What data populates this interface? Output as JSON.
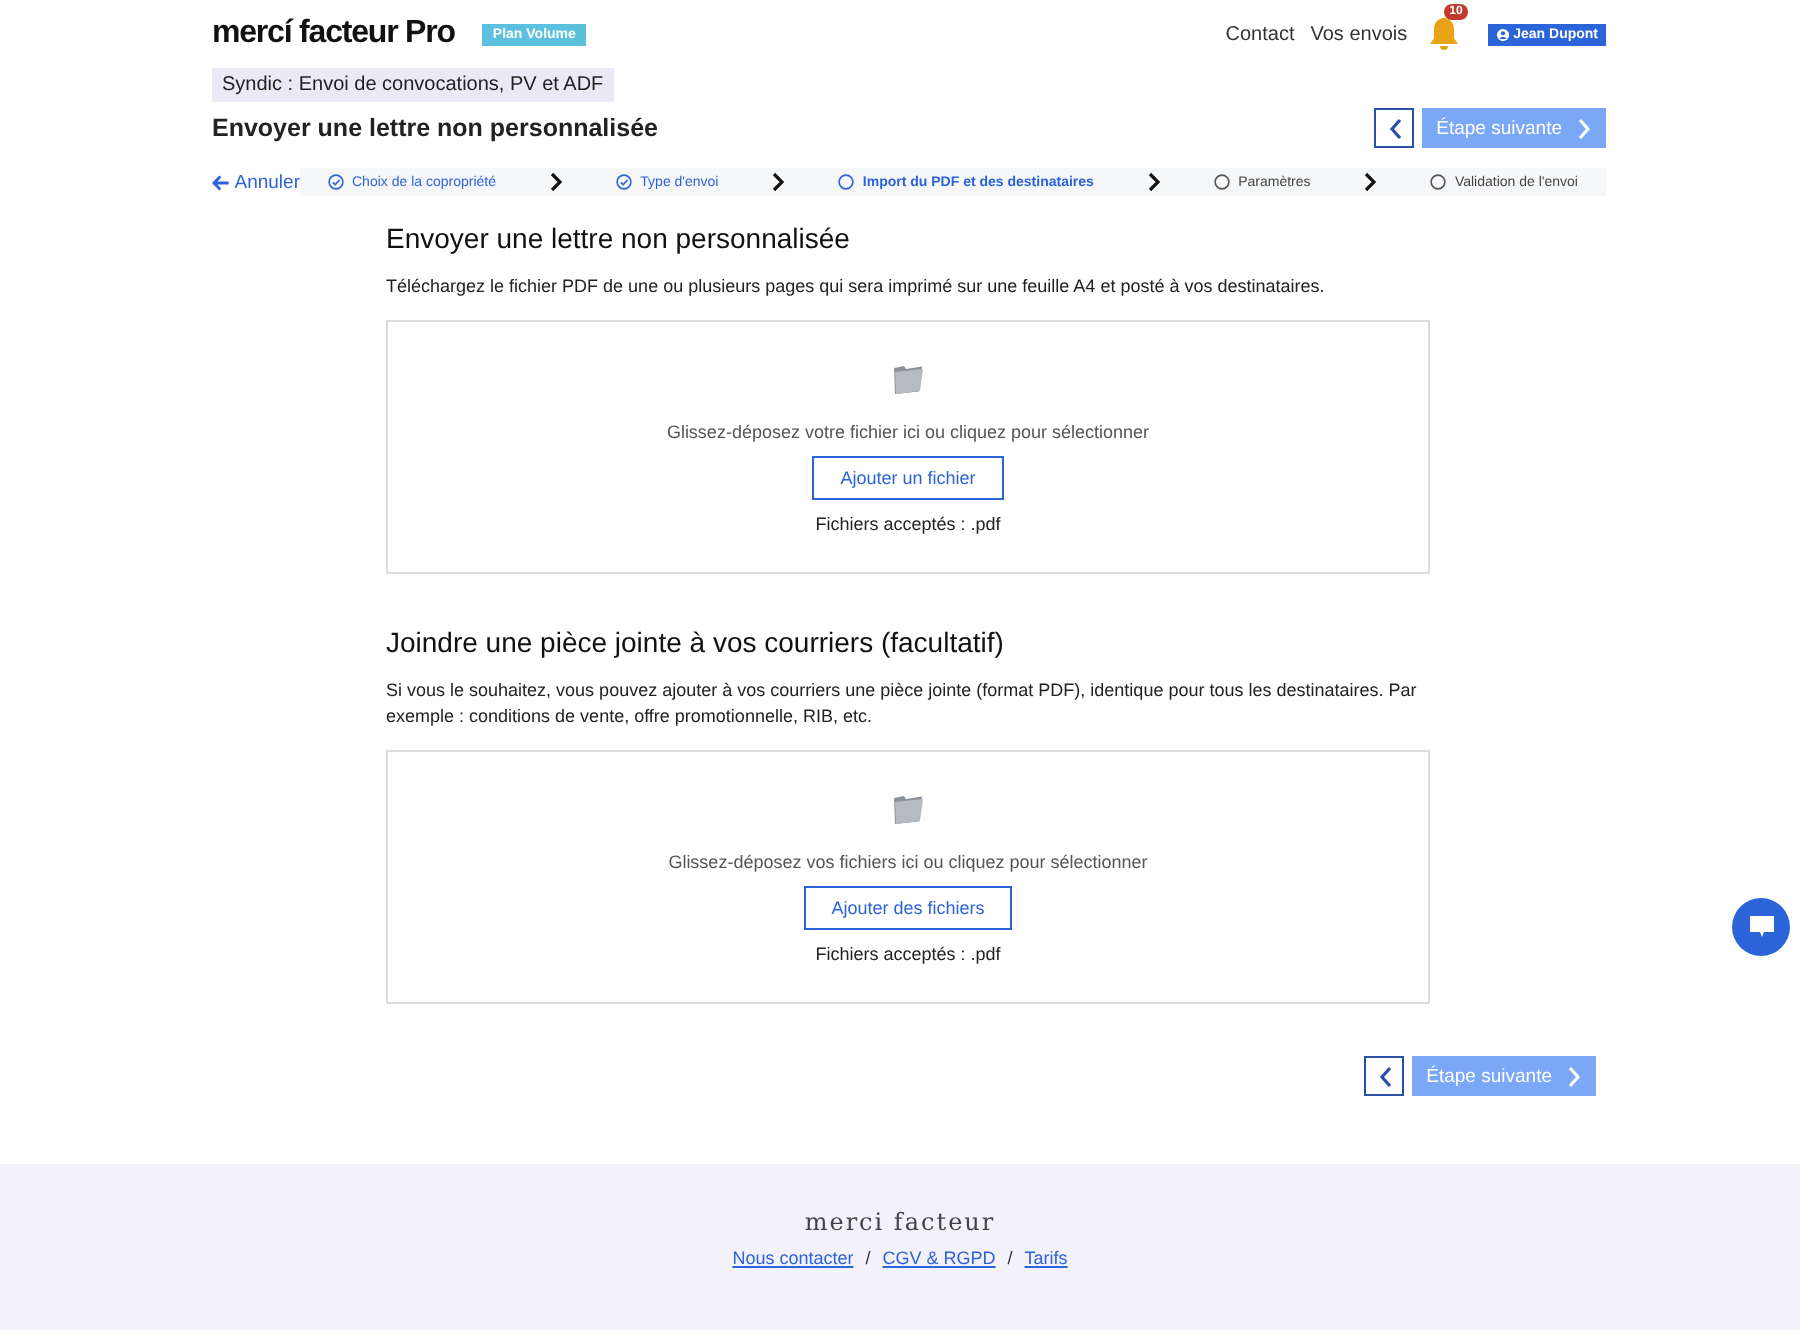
{
  "header": {
    "logo": "mercí facteur Pro",
    "plan_badge": "Plan Volume",
    "nav": [
      "Contact",
      "Vos envois"
    ],
    "notification_count": "10",
    "user": "Jean Dupont"
  },
  "context_tag": "Syndic : Envoi de convocations, PV et ADF",
  "page_title": "Envoyer une lettre non personnalisée",
  "next_button": "Étape suivante",
  "bottom_next_button": "Étape suivante",
  "cancel": "Annuler",
  "steps": [
    {
      "label": "Choix de la copropriété",
      "kind": "done",
      "selected": false
    },
    {
      "label": "Type d'envoi",
      "kind": "done",
      "selected": false
    },
    {
      "label": "Import du PDF et des destinataires",
      "kind": "pending",
      "selected": true
    },
    {
      "label": "Paramètres",
      "kind": "pending",
      "selected": false
    },
    {
      "label": "Validation de l'envoi",
      "kind": "pending",
      "selected": false
    }
  ],
  "sections": [
    {
      "title": "Envoyer une lettre non personnalisée",
      "description": "Téléchargez le fichier PDF de une ou plusieurs pages qui sera imprimé sur une feuille A4 et posté à vos destinataires.",
      "drop_hint": "Glissez-déposez votre fichier ici ou cliquez pour sélectionner",
      "button": "Ajouter un fichier",
      "accepted": "Fichiers acceptés : .pdf"
    },
    {
      "title": "Joindre une pièce jointe à vos courriers (facultatif)",
      "description": "Si vous le souhaitez, vous pouvez ajouter à vos courriers une pièce jointe (format PDF), identique pour tous les destinataires. Par exemple : conditions de vente, offre promotionnelle, RIB, etc.",
      "drop_hint": "Glissez-déposez vos fichiers ici ou cliquez pour sélectionner",
      "button": "Ajouter des fichiers",
      "accepted": "Fichiers acceptés : .pdf"
    }
  ],
  "footer": {
    "logo": "merci facteur",
    "links": [
      "Nous contacter",
      "CGV & RGPD",
      "Tarifs"
    ],
    "separators": [
      "/",
      "/"
    ]
  }
}
